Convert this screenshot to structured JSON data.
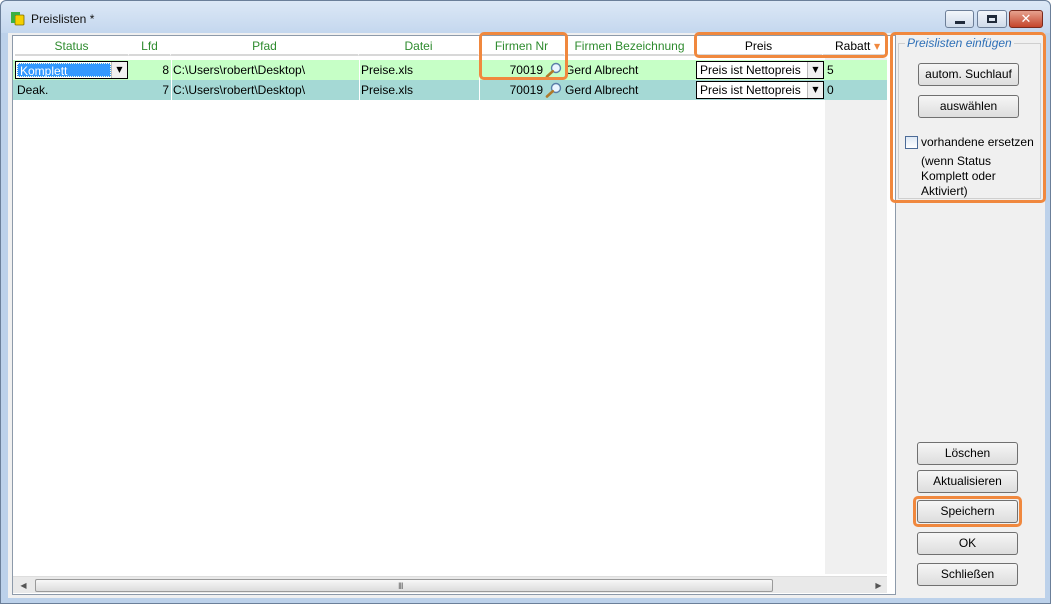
{
  "window": {
    "title": "Preislisten *"
  },
  "grid": {
    "columns": [
      "Status",
      "Lfd",
      "Pfad",
      "Datei",
      "Firmen Nr",
      "Firmen Bezeichnung",
      "Preis",
      "Rabatt"
    ],
    "rows": [
      {
        "status": "Komplett",
        "lfd": "8",
        "pfad": "C:\\Users\\robert\\Desktop\\",
        "datei": "Preise.xls",
        "firmen_nr": "70019",
        "firmen_bezeichnung": "Gerd Albrecht",
        "preis": "Preis ist Nettopreis",
        "rabatt": "5"
      },
      {
        "status": "Deak.",
        "lfd": "7",
        "pfad": "C:\\Users\\robert\\Desktop\\",
        "datei": "Preise.xls",
        "firmen_nr": "70019",
        "firmen_bezeichnung": "Gerd Albrecht",
        "preis": "Preis ist Nettopreis",
        "rabatt": "0"
      }
    ],
    "scroll_grip": "III"
  },
  "panel": {
    "group_title": "Preislisten einfügen",
    "auto_search_label": "autom. Suchlauf",
    "select_label": "auswählen",
    "replace_checkbox_label": "vorhandene ersetzen",
    "replace_checkbox_checked": false,
    "note": "(wenn Status Komplett oder Aktiviert)"
  },
  "actions": {
    "delete_label": "Löschen",
    "refresh_label": "Aktualisieren",
    "save_label": "Speichern",
    "ok_label": "OK",
    "close_label": "Schließen"
  },
  "colors": {
    "header_text": "#2e8b2e",
    "row_selected_bg": "#c6ffc6",
    "row_alt_bg": "#a5d9d5",
    "highlight": "#f0883e",
    "group_title": "#2d6fb7"
  },
  "icons": [
    "app-icon",
    "minimize-icon",
    "maximize-icon",
    "close-icon",
    "magnifier-icon",
    "sort-desc-icon",
    "dropdown-arrow-icon"
  ]
}
